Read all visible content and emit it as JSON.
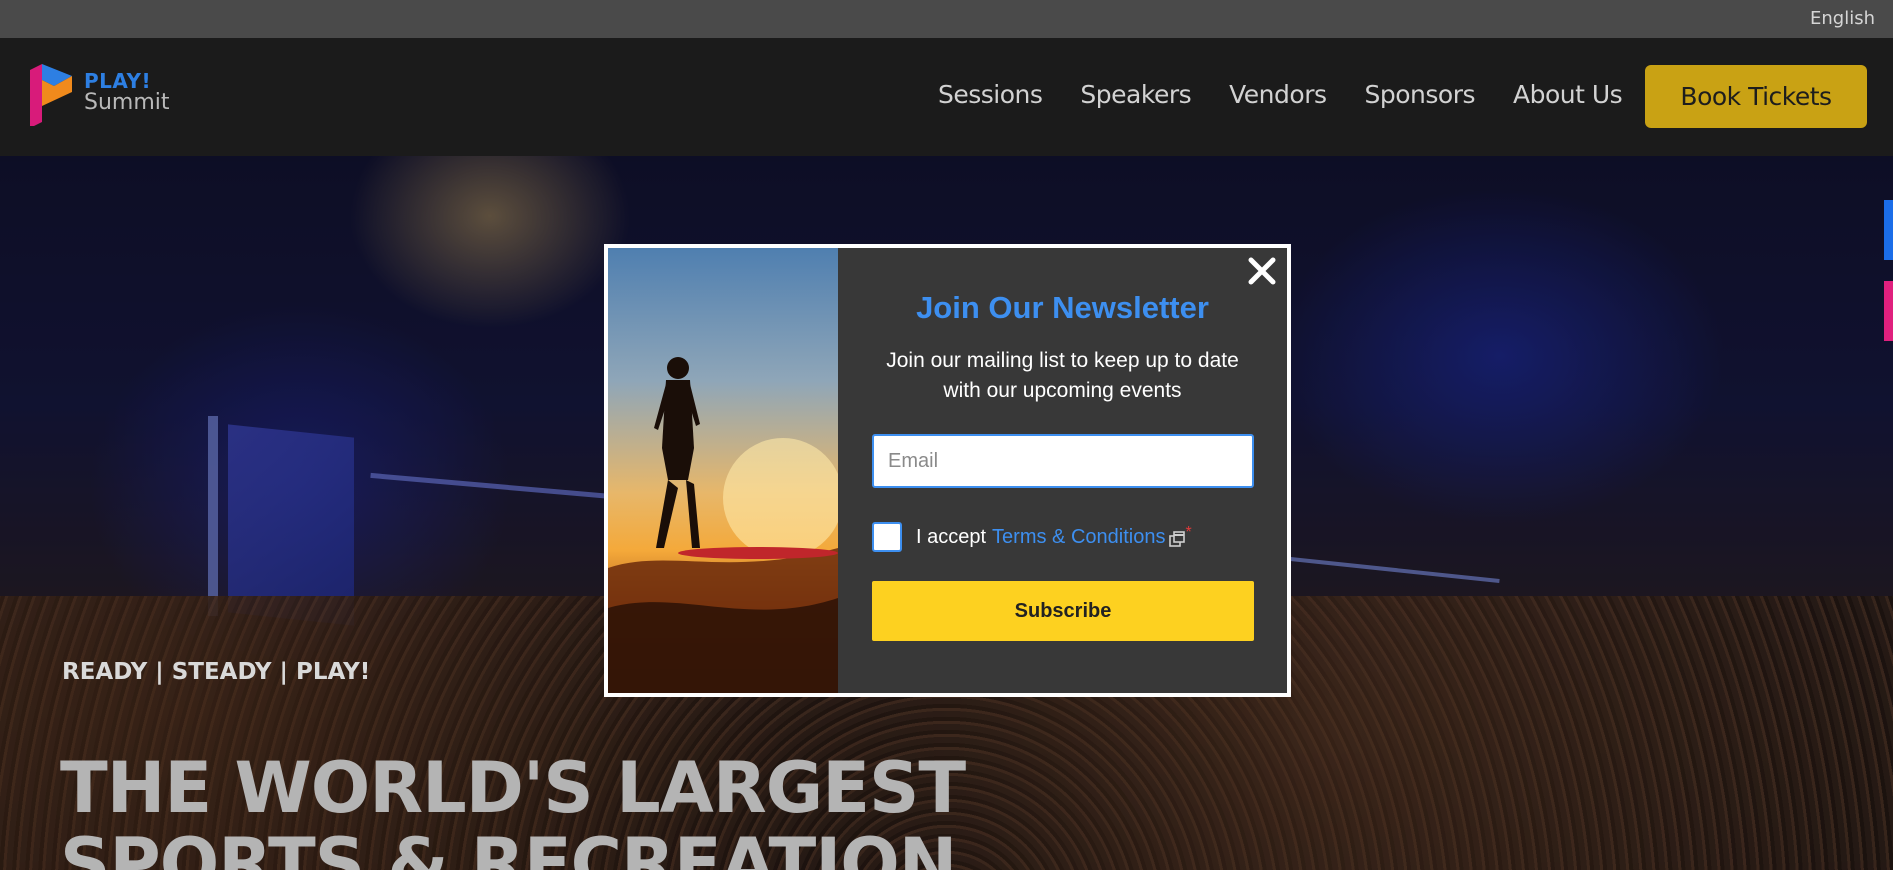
{
  "topbar": {
    "language": "English"
  },
  "header": {
    "logo": {
      "line1": "PLAY!",
      "line2": "Summit"
    },
    "nav": [
      {
        "label": "Sessions"
      },
      {
        "label": "Speakers"
      },
      {
        "label": "Vendors"
      },
      {
        "label": "Sponsors"
      },
      {
        "label": "About Us"
      }
    ],
    "cta_label": "Book Tickets"
  },
  "hero": {
    "tagline": "READY | STEADY | PLAY!",
    "title": "THE WORLD'S LARGEST SPORTS & RECREATION"
  },
  "modal": {
    "title": "Join Our Newsletter",
    "description": "Join our mailing list to keep up to date with our upcoming events",
    "email_placeholder": "Email",
    "terms_prefix": "I accept",
    "terms_link": "Terms & Conditions",
    "required_mark": "*",
    "subscribe_label": "Subscribe"
  },
  "colors": {
    "accent_blue": "#3d8ff0",
    "subscribe_yellow": "#fdd120",
    "book_gold": "#c9a214",
    "side_tab_blue": "#1b6de8",
    "side_tab_pink": "#e0207e"
  },
  "icons": {
    "close": "close-icon",
    "external_link": "external-link-icon"
  }
}
